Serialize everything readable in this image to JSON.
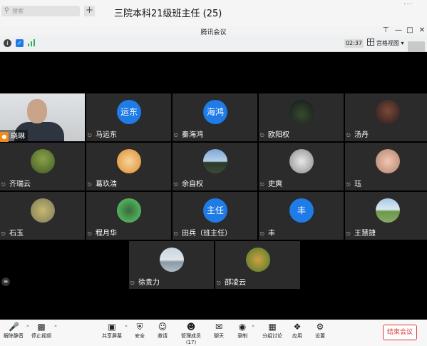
{
  "chat": {
    "search_placeholder": "搜索",
    "plus": "+",
    "title": "三院本科21级班主任 (25)",
    "more": "..."
  },
  "meeting": {
    "window_title": "腾讯会议",
    "time": "02:37",
    "view_label": "宫格视图",
    "participants": [
      {
        "name": "晓琳",
        "avatar_text": "",
        "self": true
      },
      {
        "name": "马运东",
        "avatar_text": "运东"
      },
      {
        "name": "秦海鸿",
        "avatar_text": "海鸿"
      },
      {
        "name": "欧阳权",
        "avatar_text": ""
      },
      {
        "name": "汤丹",
        "avatar_text": ""
      },
      {
        "name": "齐瑞云",
        "avatar_text": ""
      },
      {
        "name": "葛玖浩",
        "avatar_text": ""
      },
      {
        "name": "余自权",
        "avatar_text": ""
      },
      {
        "name": "史爽",
        "avatar_text": ""
      },
      {
        "name": "珏",
        "avatar_text": ""
      },
      {
        "name": "石玉",
        "avatar_text": ""
      },
      {
        "name": "程月华",
        "avatar_text": ""
      },
      {
        "name": "田兵（班主任）",
        "avatar_text": "主任"
      },
      {
        "name": "丰",
        "avatar_text": "丰"
      },
      {
        "name": "王慧捷",
        "avatar_text": ""
      },
      {
        "name": "徐贵力",
        "avatar_text": ""
      },
      {
        "name": "邵凌云",
        "avatar_text": ""
      }
    ],
    "toolbar": {
      "mute": "解除静音",
      "video": "停止视频",
      "share": "共享屏幕",
      "security": "安全",
      "invite": "邀请",
      "members": "管理成员(17)",
      "chat": "聊天",
      "record": "录制",
      "breakout": "分组讨论",
      "apps": "应用",
      "settings": "设置",
      "end": "结束会议"
    }
  }
}
